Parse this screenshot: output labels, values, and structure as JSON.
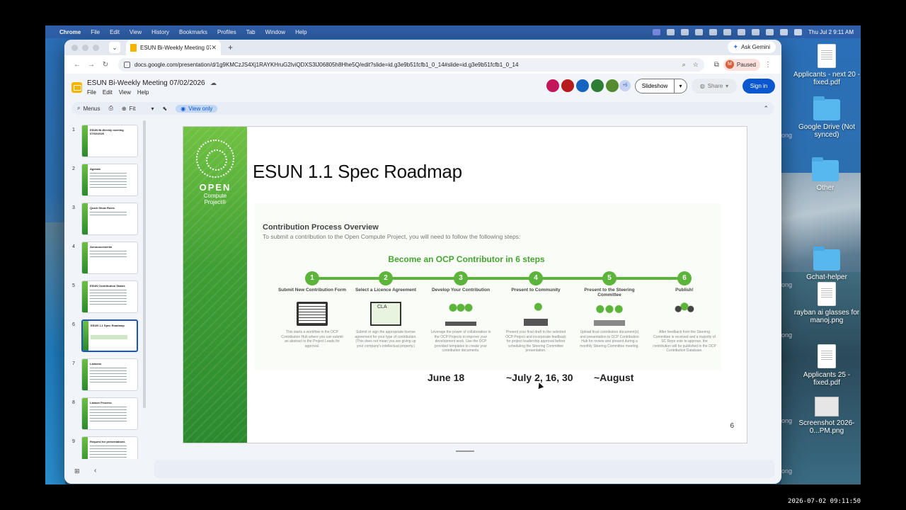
{
  "menubar": {
    "app": "Chrome",
    "items": [
      "File",
      "Edit",
      "View",
      "History",
      "Bookmarks",
      "Profiles",
      "Tab",
      "Window",
      "Help"
    ],
    "datetime": "Thu Jul 2  9:11 AM"
  },
  "desktop": {
    "items": [
      {
        "label": "Applicants - next 20 - fixed.pdf",
        "icon": "pdf-file-icon"
      },
      {
        "label": "Google Drive (Not synced)",
        "icon": "folder-icon"
      },
      {
        "label": "Other",
        "icon": "folder-icon"
      },
      {
        "label": "Gchat-helper",
        "icon": "folder-icon"
      },
      {
        "label": "rayban ai glasses for manoj.png",
        "icon": "png-file-icon"
      },
      {
        "label": "Applicants 25 - fixed.pdf",
        "icon": "pdf-file-icon"
      },
      {
        "label": "Screenshot 2026-0...PM.png",
        "icon": "screenshot-file-icon"
      }
    ],
    "side_text": "ong"
  },
  "browser": {
    "tab_title": "ESUN Bi-Weekly Meeting 07/",
    "ask_gemini": "Ask Gemini",
    "url": "docs.google.com/presentation/d/1g9KMCzJS4Xj1RAYKHruG2lviQDXS3lJ06805h8Hhe5Q/edit?slide=id.g3e9b51fcfb1_0_14#slide=id.g3e9b51fcfb1_0_14",
    "profile_initial": "M",
    "profile_status": "Paused"
  },
  "slides": {
    "doc_title": "ESUN Bi-Weekly Meeting 07/02/2026",
    "menus": [
      "File",
      "Edit",
      "View",
      "Help"
    ],
    "collab_more": "+5",
    "slideshow": "Slideshow",
    "share": "Share",
    "sign_in": "Sign in",
    "toolbar": {
      "menus": "Menus",
      "zoom": "Fit",
      "view_only": "View only"
    },
    "thumbnails": [
      {
        "num": "1",
        "title": "ESUN Bi-Weekly meeting 07/02/2026"
      },
      {
        "num": "2",
        "title": "Agenda"
      },
      {
        "num": "3",
        "title": "Quick Show Rules"
      },
      {
        "num": "4",
        "title": "Announcements"
      },
      {
        "num": "5",
        "title": "ESUN Contribution Status"
      },
      {
        "num": "6",
        "title": "ESUN 1.1 Spec Roadmap"
      },
      {
        "num": "7",
        "title": "Liaisons"
      },
      {
        "num": "8",
        "title": "Liaison Process"
      },
      {
        "num": "9",
        "title": "Request for presentations"
      }
    ],
    "current_slide": {
      "title": "ESUN 1.1 Spec Roadmap",
      "logo": {
        "word": "OPEN",
        "sub1": "Compute",
        "sub2": "Project®"
      },
      "process_title": "Contribution Process Overview",
      "process_sub": "To submit a contribution to the Open Compute Project, you will need to follow the following steps:",
      "steps_title": "Become an OCP Contributor in 6 steps",
      "steps": [
        {
          "n": "1",
          "title": "Submit New Contribution Form",
          "desc": "This starts a workflow in the OCP Contribution Hub where you can submit an abstract to the Project Leads for approval."
        },
        {
          "n": "2",
          "title": "Select a Licence Agreement",
          "desc": "Submit or sign the appropriate license agreement for your type of contribution. (This does not mean you are giving up your company's intellectual property.)"
        },
        {
          "n": "3",
          "title": "Develop Your Contribution",
          "desc": "Leverage the power of collaboration in the OCP Projects to improve your development work. Use the OCP provided templates to create your contribution documents."
        },
        {
          "n": "4",
          "title": "Present to Community",
          "desc": "Present your final draft to the selected OCP Project and incorporate feedback for project leadership approval before scheduling the Steering Committee presentation."
        },
        {
          "n": "5",
          "title": "Present to the Steering Committee",
          "desc": "Upload final contribution document(s) and presentation to OCP Contribution Hub for review and present during a monthly Steering Committee meeting."
        },
        {
          "n": "6",
          "title": "Publish!",
          "desc": "After feedback from the Steering Committee is received and a majority of SC Reps vote to approve, the contribution will be published in the OCP Contribution Database."
        }
      ],
      "dates": [
        "June  18",
        "~July 2, 16, 30",
        "~August"
      ],
      "page_number": "6"
    }
  },
  "clock": "2026-07-02 09:11:50",
  "colors": {
    "ocp_green": "#5cb43a",
    "signin_blue": "#0b57d0",
    "menubar": "#2f5fa8"
  }
}
